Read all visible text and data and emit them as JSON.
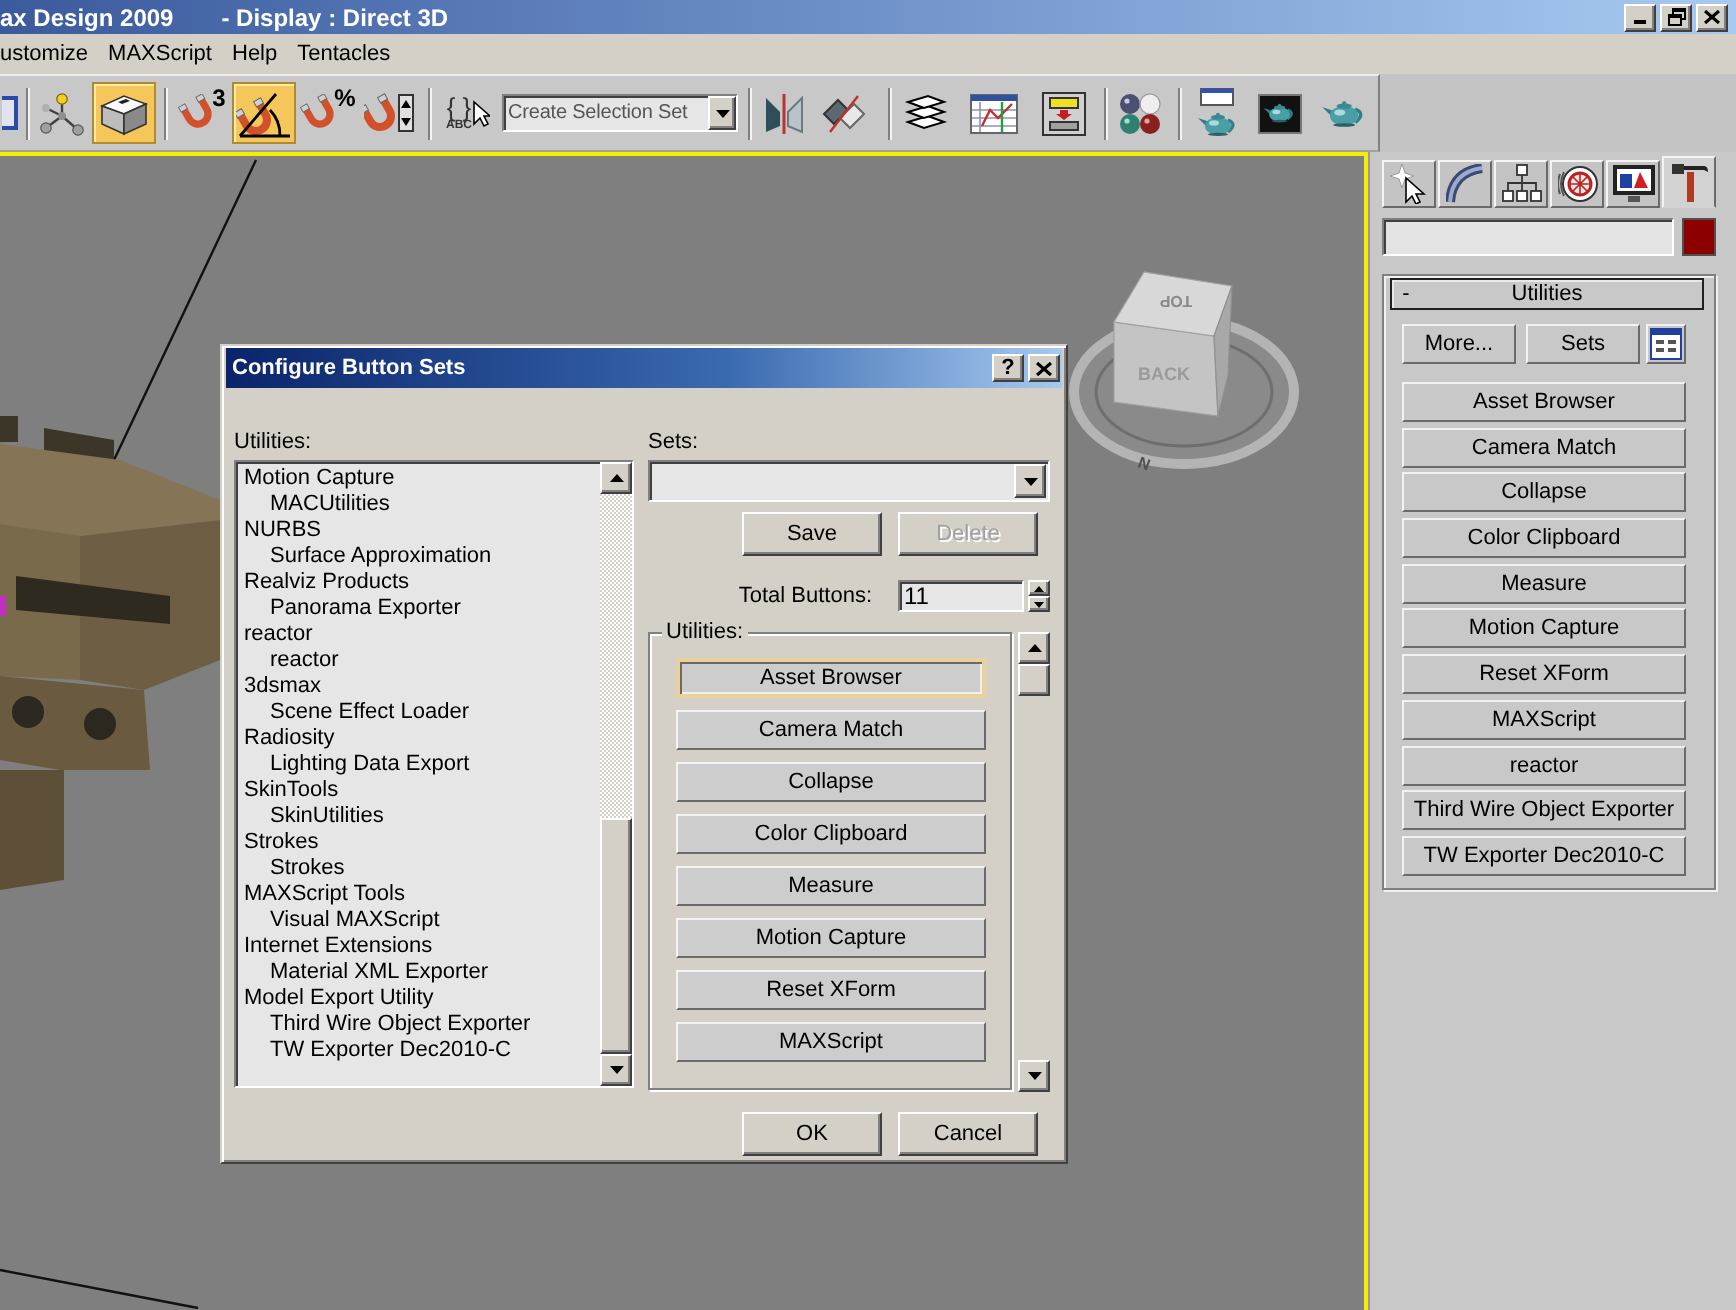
{
  "window": {
    "title": "ax Design 2009",
    "display": "- Display : Direct 3D"
  },
  "menu": [
    {
      "label": "ustomize"
    },
    {
      "label": "MAXScript"
    },
    {
      "label": "Help"
    },
    {
      "label": "Tentacles"
    }
  ],
  "toolbar": {
    "items": [
      {
        "kind": "button",
        "on": false
      },
      {
        "kind": "separator"
      },
      {
        "kind": "button",
        "on": false
      },
      {
        "kind": "button",
        "on": true
      },
      {
        "kind": "separator"
      },
      {
        "kind": "button",
        "on": false,
        "badge": "3"
      },
      {
        "kind": "button",
        "on": true
      },
      {
        "kind": "button",
        "on": false,
        "badge": "%"
      },
      {
        "kind": "button",
        "on": false
      },
      {
        "kind": "separator"
      },
      {
        "kind": "button",
        "on": false,
        "glyph": "{ }",
        "caption": "ABC"
      },
      {
        "kind": "dropdown",
        "placeholder": "Create Selection Set"
      },
      {
        "kind": "separator"
      },
      {
        "kind": "button",
        "on": false
      },
      {
        "kind": "button",
        "on": false
      },
      {
        "kind": "separator"
      },
      {
        "kind": "button",
        "on": false
      },
      {
        "kind": "button",
        "on": false
      },
      {
        "kind": "button",
        "on": false
      },
      {
        "kind": "separator"
      },
      {
        "kind": "button",
        "on": false
      },
      {
        "kind": "separator"
      },
      {
        "kind": "button",
        "on": false
      },
      {
        "kind": "button",
        "on": false
      },
      {
        "kind": "button",
        "on": false
      }
    ]
  },
  "viewport": {
    "viewcube": {
      "top": "TOP",
      "front": "BACK",
      "compass": "N"
    }
  },
  "dialog": {
    "title": "Configure Button Sets",
    "help": "?",
    "list_label": "Utilities:",
    "list": [
      {
        "label": "Motion Capture",
        "selected": false,
        "children": [
          {
            "label": "MACUtilities",
            "selected": false
          }
        ]
      },
      {
        "label": "NURBS",
        "selected": false,
        "children": [
          {
            "label": "Surface Approximation",
            "selected": false
          }
        ]
      },
      {
        "label": "Realviz Products",
        "selected": false,
        "children": [
          {
            "label": "Panorama Exporter",
            "selected": false
          }
        ]
      },
      {
        "label": "reactor",
        "selected": false,
        "children": [
          {
            "label": "reactor",
            "selected": false
          }
        ]
      },
      {
        "label": "3dsmax",
        "selected": false,
        "children": [
          {
            "label": "Scene Effect Loader",
            "selected": false
          }
        ]
      },
      {
        "label": "Radiosity",
        "selected": false,
        "children": [
          {
            "label": "Lighting Data Export",
            "selected": false
          }
        ]
      },
      {
        "label": "SkinTools",
        "selected": false,
        "children": [
          {
            "label": "SkinUtilities",
            "selected": false
          }
        ]
      },
      {
        "label": "Strokes",
        "selected": false,
        "children": [
          {
            "label": "Strokes",
            "selected": false
          }
        ]
      },
      {
        "label": "MAXScript Tools",
        "selected": false,
        "children": [
          {
            "label": "Visual MAXScript",
            "selected": false
          }
        ]
      },
      {
        "label": "Internet Extensions",
        "selected": false,
        "children": [
          {
            "label": "Material XML Exporter",
            "selected": false
          }
        ]
      },
      {
        "label": "Model Export Utility",
        "selected": false,
        "children": [
          {
            "label": "Third Wire Object Exporter",
            "selected": false
          },
          {
            "label": "TW Exporter Dec2010-C",
            "selected": false
          }
        ]
      }
    ],
    "sets_label": "Sets:",
    "set_buttons": [
      {
        "label": "Save",
        "disabled": false
      },
      {
        "label": "Delete",
        "disabled": true
      }
    ],
    "total_label": "Total Buttons:",
    "total_value": "11",
    "group_label": "Utilities:",
    "group_buttons": [
      {
        "label": "Asset Browser",
        "focused": true
      },
      {
        "label": "Camera Match",
        "focused": false
      },
      {
        "label": "Collapse",
        "focused": false
      },
      {
        "label": "Color Clipboard",
        "focused": false
      },
      {
        "label": "Measure",
        "focused": false
      },
      {
        "label": "Motion Capture",
        "focused": false
      },
      {
        "label": "Reset XForm",
        "focused": false
      },
      {
        "label": "MAXScript",
        "focused": false
      }
    ],
    "footer_buttons": [
      {
        "label": "OK"
      },
      {
        "label": "Cancel"
      }
    ]
  },
  "command_panel": {
    "tabs": [
      {
        "selected": false
      },
      {
        "selected": false
      },
      {
        "selected": false
      },
      {
        "selected": false
      },
      {
        "selected": false
      },
      {
        "selected": true
      }
    ],
    "rollout": {
      "toggle": "-",
      "title": "Utilities",
      "actions": [
        {
          "label": "More..."
        },
        {
          "label": "Sets"
        }
      ],
      "buttons": [
        {
          "label": "Asset Browser"
        },
        {
          "label": "Camera Match"
        },
        {
          "label": "Collapse"
        },
        {
          "label": "Color Clipboard"
        },
        {
          "label": "Measure"
        },
        {
          "label": "Motion Capture"
        },
        {
          "label": "Reset XForm"
        },
        {
          "label": "MAXScript"
        },
        {
          "label": "reactor"
        },
        {
          "label": "Third Wire Object Exporter"
        },
        {
          "label": "TW Exporter Dec2010-C"
        }
      ]
    }
  }
}
